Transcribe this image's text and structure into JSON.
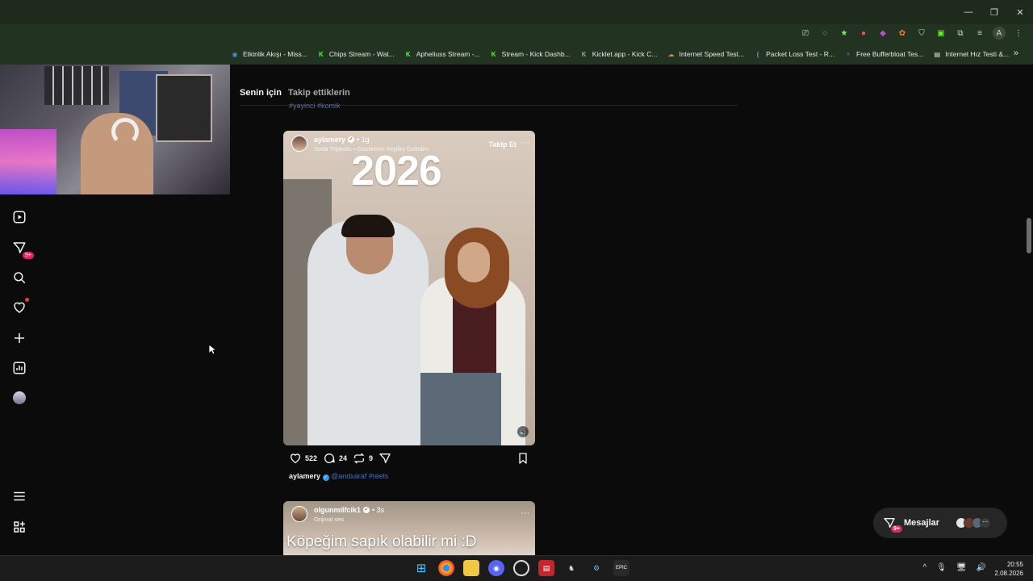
{
  "window": {
    "minimize": "—",
    "maximize": "❐",
    "close": "✕"
  },
  "bookmarks": [
    {
      "label": "Etkinlik Akışı - Miss...",
      "icon": "globe-icon",
      "color": "#4a90d9",
      "glyph": "◉"
    },
    {
      "label": "Chips Stream - Wat...",
      "icon": "kick-icon",
      "color": "#53fc18",
      "glyph": "K"
    },
    {
      "label": "Apheliuss Stream -...",
      "icon": "kick-icon",
      "color": "#53fc18",
      "glyph": "K"
    },
    {
      "label": "Stream - Kick Dashb...",
      "icon": "kick-icon",
      "color": "#53fc18",
      "glyph": "K"
    },
    {
      "label": "Kicklet.app - Kick C...",
      "icon": "kicklet-icon",
      "color": "#9aa0a6",
      "glyph": "K"
    },
    {
      "label": "Internet Speed Test...",
      "icon": "cloud-icon",
      "color": "#f48120",
      "glyph": "☁"
    },
    {
      "label": "Packet Loss Test - R...",
      "icon": "packet-icon",
      "color": "#5aa0e0",
      "glyph": "("
    },
    {
      "label": "Free Bufferbloat Tes...",
      "icon": "bolt-icon",
      "color": "#3b82f6",
      "glyph": "⚡"
    },
    {
      "label": "Internet Hız Testi &...",
      "icon": "page-icon",
      "color": "#e8e8e8",
      "glyph": "▤"
    }
  ],
  "sidebar": {
    "notifications_badge": "9+"
  },
  "feed": {
    "tab_active": "Senin için",
    "tab_inactive": "Takip ettiklerin",
    "prev_tags": "#yayinci #komik"
  },
  "post": {
    "username": "aylamery",
    "age": "• 1g",
    "audio": "Seda Tripkolic • Gözlerinin Yeşilini Özledim",
    "follow": "Takip Et",
    "more": "···",
    "overlay_title": "2026",
    "likes": "522",
    "comments": "24",
    "reposts": "9",
    "caption_user": "aylamery",
    "caption_tags": "@andxaraf #reels"
  },
  "post2": {
    "username": "olgunmilfcik1",
    "age": "• 3s",
    "audio": "Orijinal ses",
    "more": "···",
    "overlay_title": "Köpeğim sapık olabilir mi :D"
  },
  "messages": {
    "label": "Mesajlar",
    "badge": "9+"
  },
  "taskbar": {
    "time": "20:55",
    "date": "2.08.2026"
  },
  "colors": {
    "accent_link": "#4e6fb5",
    "badge": "#e0245e"
  }
}
